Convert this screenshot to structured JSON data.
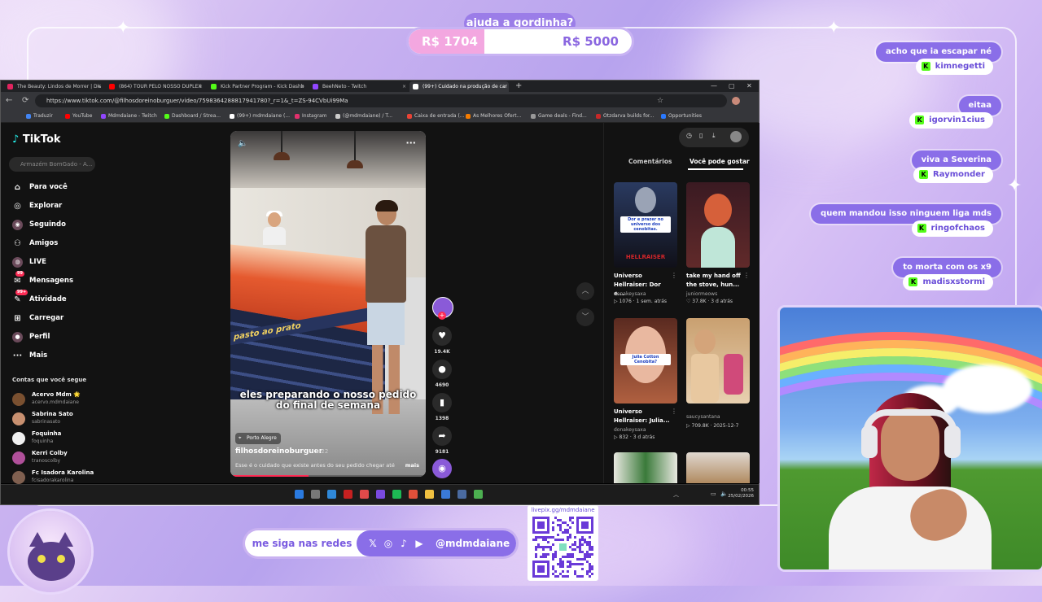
{
  "overlay": {
    "goal": {
      "title": "ajuda a gordinha?",
      "current": "R$ 1704",
      "target": "R$ 5000",
      "progress_fraction": 0.34
    },
    "socials": {
      "label": "me siga nas redes",
      "handle": "@mdmdaiane",
      "icons": [
        "x-icon",
        "instagram-icon",
        "tiktok-icon",
        "youtube-icon"
      ]
    },
    "qr": {
      "label": "livepix.gg/mdmdaiane"
    },
    "chat": [
      {
        "message": "acho que ia escapar né",
        "user": "kimnegetti"
      },
      {
        "message": "eitaa",
        "user": "igorvin1cius"
      },
      {
        "message": "viva a Severina",
        "user": "Raymonder"
      },
      {
        "message": "quem mandou isso ninguem liga mds",
        "user": "ringofchaos"
      },
      {
        "message": "to morta com os x9",
        "user": "madisxstormi"
      }
    ],
    "chat_badge": "K"
  },
  "browser": {
    "tabs": [
      {
        "title": "The Beauty: Lindos de Morrer | Dis",
        "color": "#e0245e"
      },
      {
        "title": "(864) TOUR PELO NOSSO DUPLEX",
        "color": "#ff0000"
      },
      {
        "title": "Kick Partner Program - Kick Dashb",
        "color": "#53fc18"
      },
      {
        "title": "BeehNeto - Twitch",
        "color": "#9146ff"
      },
      {
        "title": "(99+) Cuidado na produção de car",
        "color": "#ffffff",
        "active": true
      }
    ],
    "url": "https://www.tiktok.com/@filhosdoreinoburguer/video/7598364288817941780?_r=1&_t=ZS-94CVbUi99Ma",
    "bookmarks": [
      {
        "label": "Traduzir",
        "color": "#4285f4"
      },
      {
        "label": "YouTube",
        "color": "#ff0000"
      },
      {
        "label": "Mdmdaiane - Twitch",
        "color": "#9146ff"
      },
      {
        "label": "Dashboard / Strea...",
        "color": "#53fc18"
      },
      {
        "label": "(99+) mdmdaiane (...",
        "color": "#ffffff"
      },
      {
        "label": "Instagram",
        "color": "#e1306c"
      },
      {
        "label": "(@mdmdaiane) / T...",
        "color": "#cccccc"
      },
      {
        "label": "Caixa de entrada (...",
        "color": "#ea4335"
      },
      {
        "label": "As Melhores Ofert...",
        "color": "#f57c00"
      },
      {
        "label": "Game deals - Find...",
        "color": "#999999"
      },
      {
        "label": "Otzdarva builds for...",
        "color": "#c62828"
      },
      {
        "label": "Opportunities",
        "color": "#2979ff"
      }
    ]
  },
  "tiktok": {
    "logo": "TikTok",
    "search_placeholder": "Armazém BomGado - A...",
    "nav": [
      {
        "label": "Para você",
        "icon": "home-icon"
      },
      {
        "label": "Explorar",
        "icon": "compass-icon"
      },
      {
        "label": "Seguindo",
        "icon": "following-icon"
      },
      {
        "label": "Amigos",
        "icon": "friends-icon"
      },
      {
        "label": "LIVE",
        "icon": "live-icon"
      },
      {
        "label": "Mensagens",
        "icon": "message-icon",
        "badge": "99"
      },
      {
        "label": "Atividade",
        "icon": "activity-icon",
        "badge": "99+"
      },
      {
        "label": "Carregar",
        "icon": "upload-icon"
      },
      {
        "label": "Perfil",
        "icon": "profile-icon"
      },
      {
        "label": "Mais",
        "icon": "more-icon"
      }
    ],
    "following_heading": "Contas que você segue",
    "following": [
      {
        "name": "Acervo Mdm 🌟",
        "handle": "acervo.mdmdaiane",
        "color": "#7a5030"
      },
      {
        "name": "Sabrina Sato",
        "handle": "sabrinasato",
        "color": "#c89070"
      },
      {
        "name": "Foquinha",
        "handle": "foquinha",
        "color": "#f0f0f0"
      },
      {
        "name": "Kerri Colby",
        "handle": "tranoscolby",
        "color": "#b0509a"
      },
      {
        "name": "Fc Isadora Karolina",
        "handle": "fcisadorakarolina",
        "color": "#806050"
      }
    ],
    "video": {
      "caption": "eles preparando o nosso pedido do final de semana",
      "banner": "pasto ao prato",
      "location": "Porto Alegre",
      "author": "filhosdoreinoburguer",
      "date": "· 1-22",
      "description": "Esse é o cuidado que existe antes do seu pedido chegar até",
      "more": "mais",
      "likes": "19.4K",
      "comments": "4690",
      "saves": "1398",
      "shares": "9181"
    },
    "panel": {
      "tabs": [
        "Comentários",
        "Você pode gostar"
      ],
      "cards": [
        {
          "title": "Universo Hellraiser: Dor e...",
          "author": "donakeysaxa",
          "meta": "▷ 1076 · 1 sem. atrás",
          "tag": "Dor e prazer no universo dos cenobitas.",
          "poster": "HELLRAISER"
        },
        {
          "title": "take my hand off the stove, hun...",
          "author": "juniormeows",
          "meta": "♡ 37.8K · 3 d atrás"
        },
        {
          "title": "Universo Hellraiser: Julia...",
          "author": "donakeysaxa",
          "meta": "▷ 832 · 3 d atrás",
          "tag": "Julia Cotton Cenobita?"
        },
        {
          "title": "",
          "author": "saucysantana",
          "meta": "▷ 709.8K · 2025-12-7"
        }
      ]
    }
  },
  "taskbar": {
    "time": "00:55",
    "date": "25/02/2026"
  }
}
